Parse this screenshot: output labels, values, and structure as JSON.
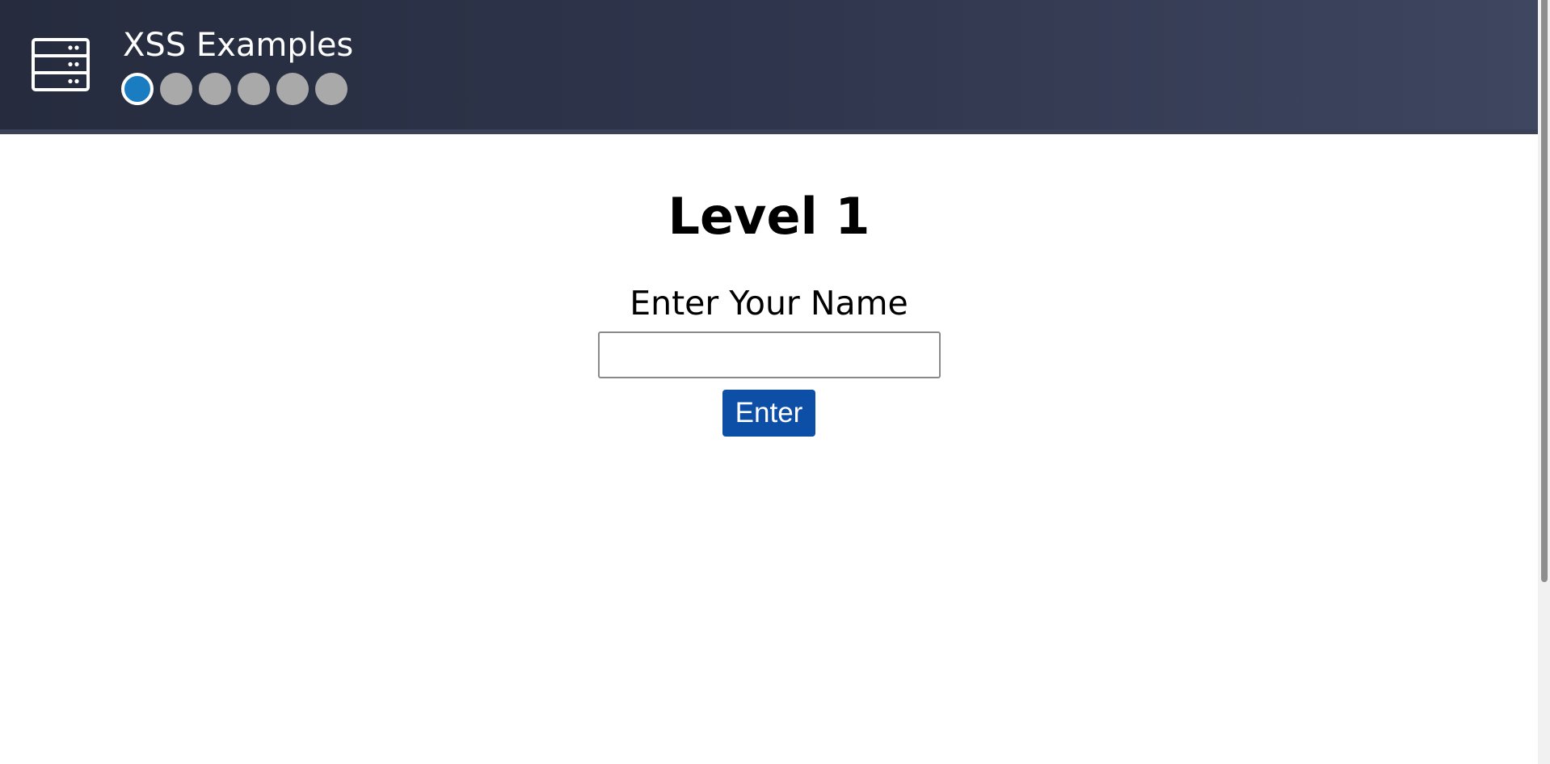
{
  "header": {
    "logo_icon": "server-stack-icon",
    "title": "XSS Examples",
    "levels": [
      {
        "state": "active"
      },
      {
        "state": "inactive"
      },
      {
        "state": "inactive"
      },
      {
        "state": "inactive"
      },
      {
        "state": "inactive"
      },
      {
        "state": "inactive"
      }
    ]
  },
  "main": {
    "heading": "Level 1",
    "name_label": "Enter Your Name",
    "name_input_value": "",
    "name_input_placeholder": "",
    "submit_label": "Enter"
  },
  "colors": {
    "header_start": "#262c3e",
    "header_end": "#3e4660",
    "active_dot": "#1a7cc1",
    "inactive_dot": "#a9a9a9",
    "button": "#0d4ea6"
  }
}
